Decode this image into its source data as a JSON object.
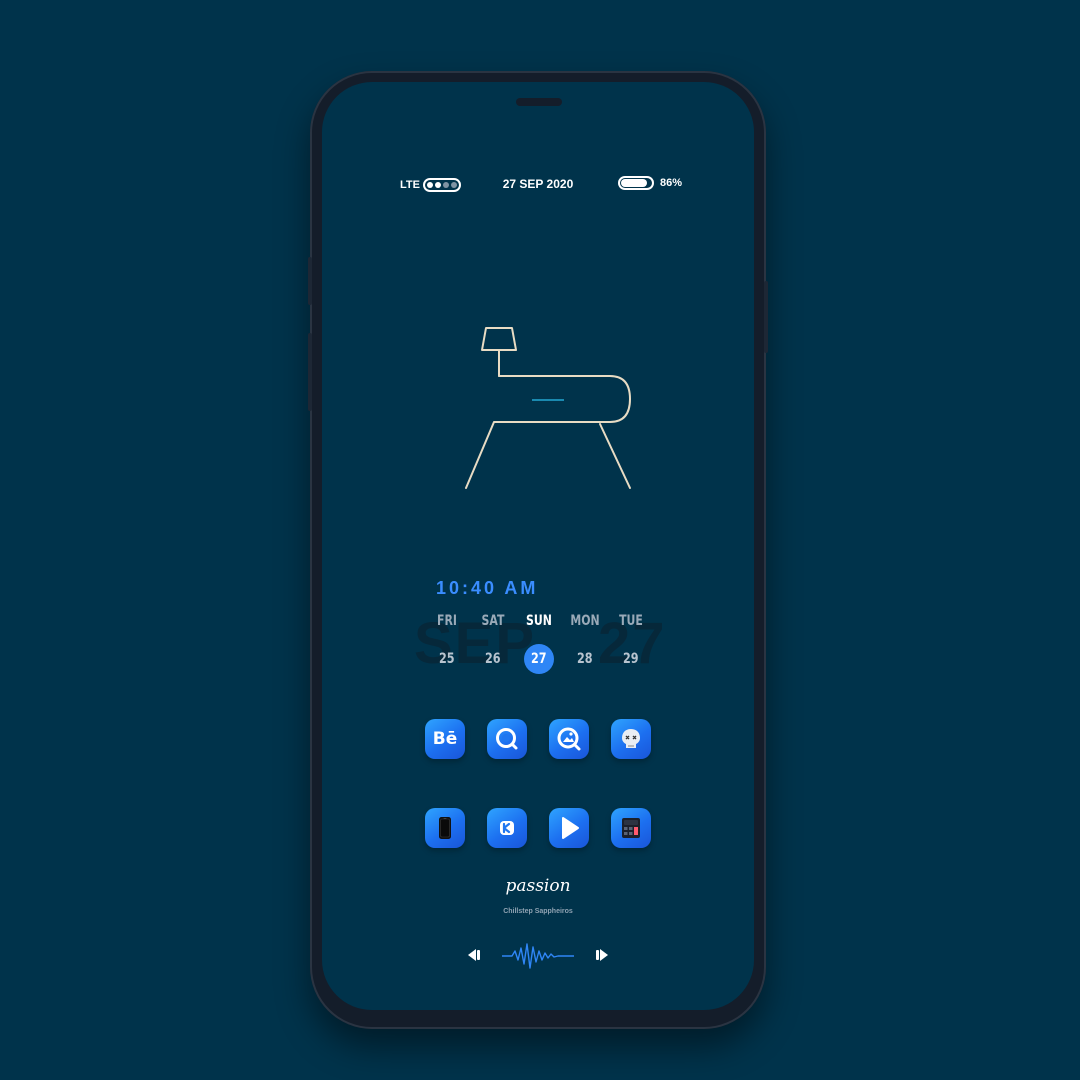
{
  "status_bar": {
    "network": "LTE",
    "date": "27 SEP 2020",
    "battery_percent": "86%",
    "battery_level": 0.86
  },
  "widget": {
    "time": "10:40 AM",
    "background_month": "SEP",
    "background_day": "27",
    "days": [
      {
        "name": "FRI",
        "num": "25"
      },
      {
        "name": "SAT",
        "num": "26"
      },
      {
        "name": "SUN",
        "num": "27"
      },
      {
        "name": "MON",
        "num": "28"
      },
      {
        "name": "TUE",
        "num": "29"
      }
    ],
    "selected_day": "27"
  },
  "apps": [
    {
      "icon": "behance-icon",
      "label": "Bē"
    },
    {
      "icon": "search-app-icon"
    },
    {
      "icon": "gallery-icon"
    },
    {
      "icon": "skull-icon"
    },
    {
      "icon": "phone-device-icon"
    },
    {
      "icon": "kodi-icon"
    },
    {
      "icon": "play-icon"
    },
    {
      "icon": "calculator-icon"
    }
  ],
  "music": {
    "title": "passion",
    "artist": "Chillstep Sappheiros"
  },
  "colors": {
    "background": "#00334b",
    "accent": "#2f86f6",
    "chair_line": "#e8dcc4"
  }
}
